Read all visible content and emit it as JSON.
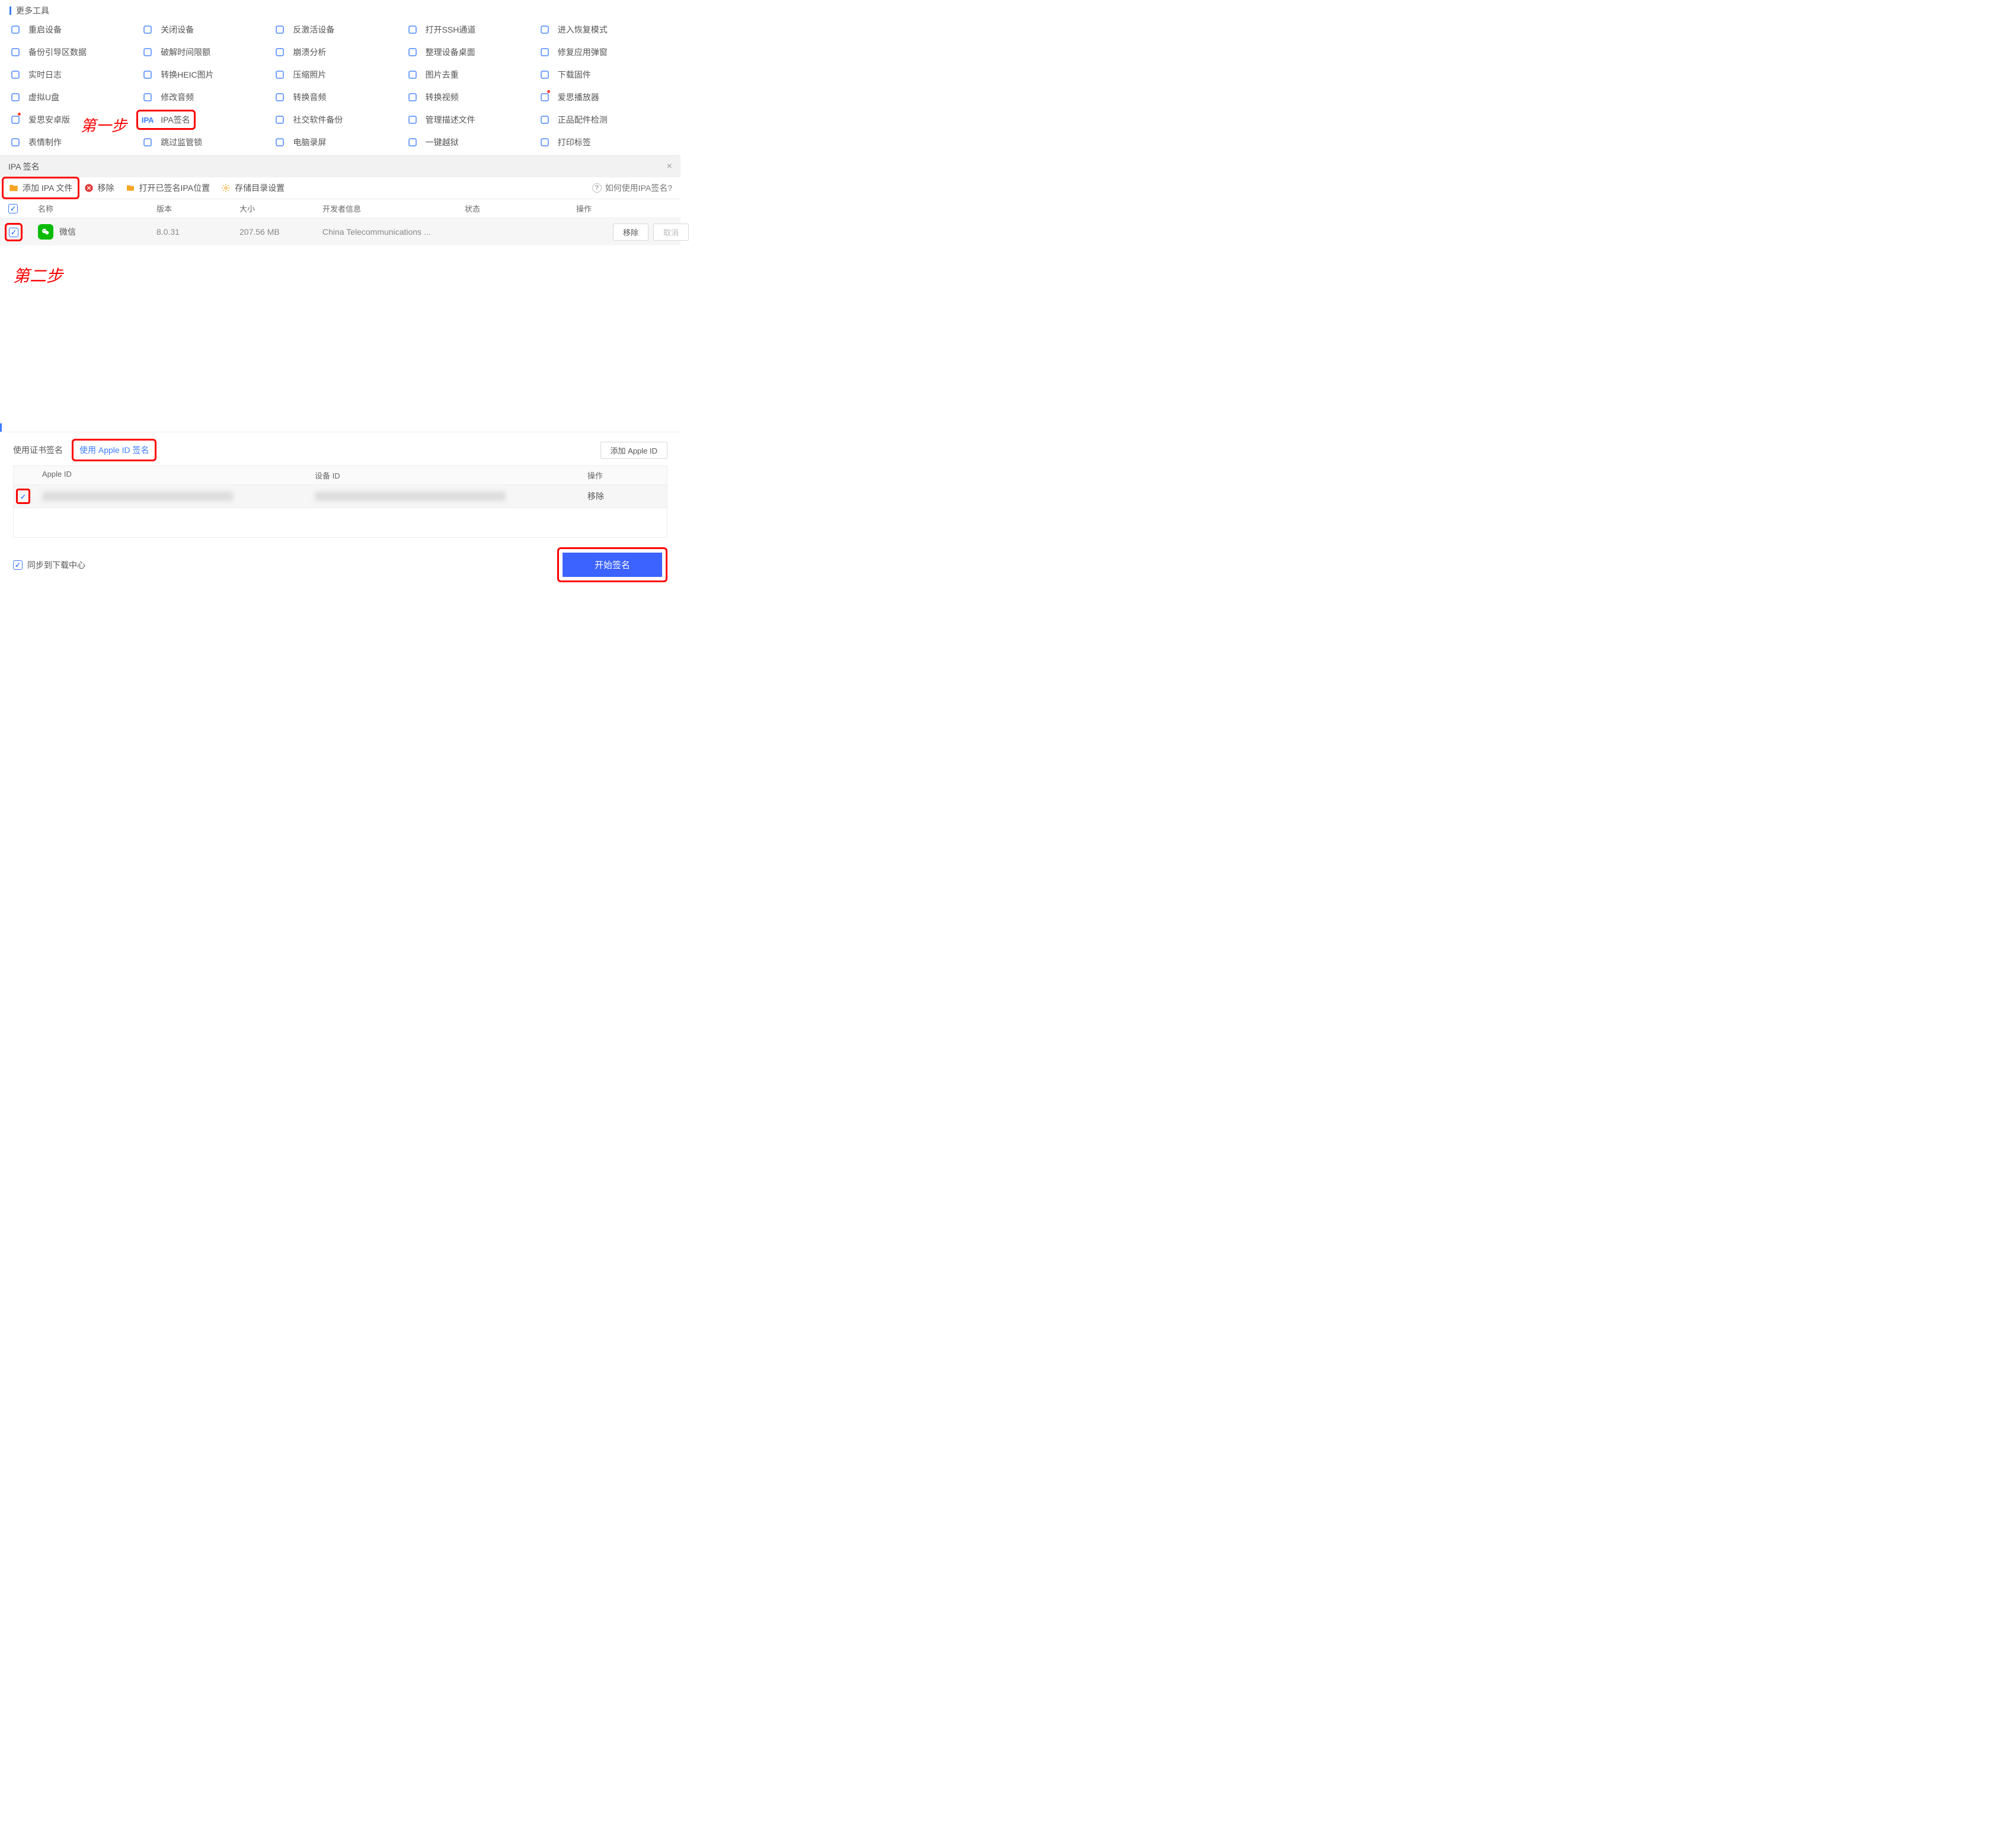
{
  "more_tools_title": "更多工具",
  "tools": [
    {
      "label": "重启设备",
      "icon": "loading-icon"
    },
    {
      "label": "关闭设备",
      "icon": "power-icon"
    },
    {
      "label": "反激活设备",
      "icon": "device-icon"
    },
    {
      "label": "打开SSH通道",
      "icon": "terminal-icon"
    },
    {
      "label": "进入恢复模式",
      "icon": "recovery-icon"
    },
    {
      "label": "备份引导区数据",
      "icon": "backup-icon"
    },
    {
      "label": "破解时间限额",
      "icon": "clock-icon"
    },
    {
      "label": "崩溃分析",
      "icon": "crash-icon"
    },
    {
      "label": "整理设备桌面",
      "icon": "grid-icon"
    },
    {
      "label": "修复应用弹窗",
      "icon": "repair-icon"
    },
    {
      "label": "实时日志",
      "icon": "log-icon"
    },
    {
      "label": "转换HEIC图片",
      "icon": "heic-icon"
    },
    {
      "label": "压缩照片",
      "icon": "compress-icon"
    },
    {
      "label": "图片去重",
      "icon": "dedupe-icon"
    },
    {
      "label": "下载固件",
      "icon": "download-icon"
    },
    {
      "label": "虚拟U盘",
      "icon": "usb-icon"
    },
    {
      "label": "修改音频",
      "icon": "audio-edit-icon"
    },
    {
      "label": "转换音频",
      "icon": "audio-convert-icon"
    },
    {
      "label": "转换视频",
      "icon": "video-convert-icon"
    },
    {
      "label": "爱思播放器",
      "icon": "player-icon",
      "red_dot": true
    },
    {
      "label": "爱思安卓版",
      "icon": "android-icon",
      "red_dot": true
    },
    {
      "label": "IPA签名",
      "icon": "ipa-icon",
      "highlight": true
    },
    {
      "label": "社交软件备份",
      "icon": "social-icon"
    },
    {
      "label": "管理描述文件",
      "icon": "profile-icon"
    },
    {
      "label": "正品配件检测",
      "icon": "auth-icon"
    },
    {
      "label": "表情制作",
      "icon": "emoji-icon"
    },
    {
      "label": "跳过监管锁",
      "icon": "skip-lock-icon"
    },
    {
      "label": "电脑录屏",
      "icon": "screen-record-icon"
    },
    {
      "label": "一键越狱",
      "icon": "jailbreak-icon"
    },
    {
      "label": "打印标签",
      "icon": "print-icon"
    }
  ],
  "tool_icons": {
    "ipa-icon": "IPA"
  },
  "annotations": {
    "step1": "第一步",
    "step2": "第二步"
  },
  "panel": {
    "title": "IPA 签名",
    "toolbar": {
      "add": "添加 IPA 文件",
      "remove": "移除",
      "open_signed_loc": "打开已签名IPA位置",
      "store_dir": "存储目录设置",
      "help": "如何使用IPA签名?"
    },
    "columns": {
      "name": "名称",
      "version": "版本",
      "size": "大小",
      "developer": "开发者信息",
      "status": "状态",
      "action": "操作"
    },
    "row": {
      "app_name": "微信",
      "version": "8.0.31",
      "size": "207.56 MB",
      "developer": "China Telecommunications ...",
      "status": "",
      "remove": "移除",
      "cancel": "取消"
    }
  },
  "bottom": {
    "tab_cert": "使用证书签名",
    "tab_appleid": "使用 Apple ID 签名",
    "add_appleid": "添加 Apple ID",
    "columns": {
      "appleid": "Apple ID",
      "deviceid": "设备 ID",
      "action": "操作"
    },
    "row_remove": "移除",
    "sync": "同步到下载中心",
    "start": "开始签名"
  }
}
